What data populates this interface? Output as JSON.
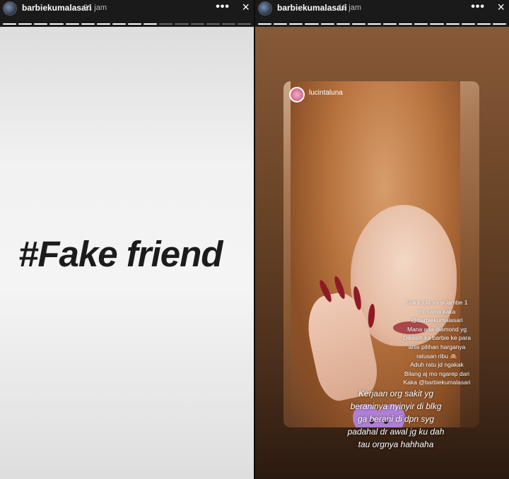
{
  "stories": [
    {
      "username": "barbiekumalasari",
      "time": "21 jam",
      "menu": "•••",
      "close": "×",
      "text": "#Fake friend"
    },
    {
      "username": "barbiekumalasari",
      "time": "12 jam",
      "menu": "•••",
      "close": "×",
      "shared": {
        "username": "lucintaluna",
        "caption": [
          "Suka julit ya si lambe 1",
          "Ini sama kaka",
          "@barbiekumalasari",
          "Mana ada diamond yg",
          "Dikasih ka barbie ke para",
          "artis pilihan harganya",
          "ratusan ribu 🙈",
          "Aduh ratu jd ngakak",
          "Bilang aj mo ngarep dari",
          "Kaka @barbiekumalasari"
        ]
      },
      "comment": [
        "Kerjaan org sakit yg",
        "beraninya nyinyir di blkg",
        "ga berani di dpn syg",
        "padahal dr awal jg ku dah",
        "tau orgnya hahhaha"
      ]
    }
  ],
  "sticker_icon": "purple-heart-face-icon"
}
